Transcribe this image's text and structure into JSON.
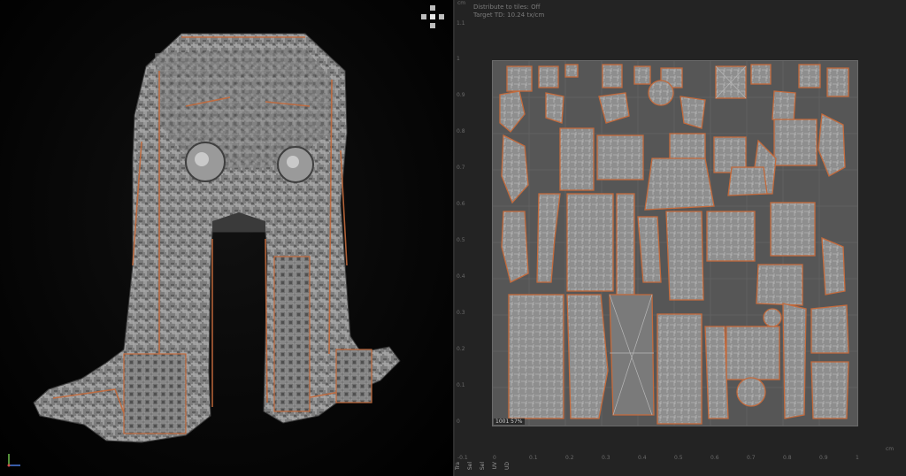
{
  "viewport3d": {
    "gizmo_icon": "view-cube-icon",
    "axis_icon": "axis-triad-icon"
  },
  "uv_editor": {
    "info_line1": "Distribute to tiles: Off",
    "info_line2": "Target TD: 10.24 tx/cm",
    "unit_top": "cm",
    "unit_bottom": "cm",
    "y_ticks": [
      "1.1",
      "1",
      "0.9",
      "0.8",
      "0.7",
      "0.6",
      "0.5",
      "0.4",
      "0.3",
      "0.2",
      "0.1",
      "0"
    ],
    "x_ticks": [
      "-0.1",
      "0",
      "0.1",
      "0.2",
      "0.3",
      "0.4",
      "0.5",
      "0.6",
      "0.7",
      "0.8",
      "0.9",
      "1"
    ],
    "udim_label": "1001   57%",
    "side_labels": [
      "Tra",
      "Sel",
      "Sel",
      "UV",
      "UD"
    ],
    "colors": {
      "background": "#232323",
      "uv_tile": "#565656",
      "island_fill": "#8e8e8e",
      "island_border": "#c36a3c"
    }
  }
}
